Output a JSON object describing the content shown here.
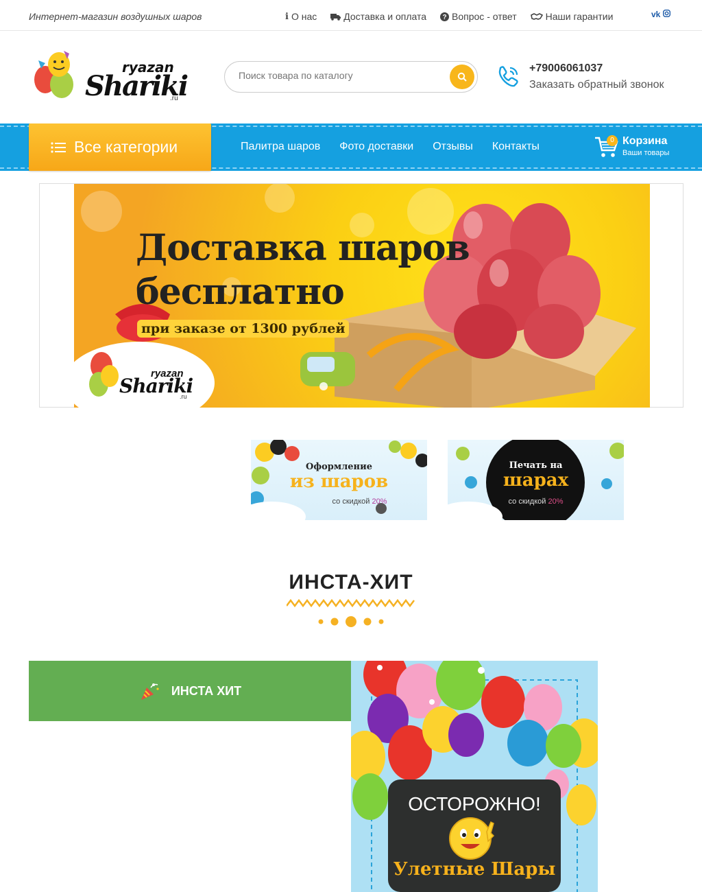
{
  "topbar": {
    "tagline": "Интернет-магазин воздушных шаров",
    "links": [
      "О нас",
      "Доставка и оплата",
      "Вопрос - ответ",
      "Наши гарантии"
    ],
    "social": [
      "vk-icon",
      "instagram-icon"
    ]
  },
  "header": {
    "logo_text": "Shariki",
    "logo_sub": "ryazan",
    "logo_domain": ".ru",
    "search_placeholder": "Поиск товара по каталогу",
    "phone": "+79006061037",
    "callback": "Заказать обратный звонок"
  },
  "nav": {
    "all_categories": "Все категории",
    "items": [
      "Палитра шаров",
      "Фото доставки",
      "Отзывы",
      "Контакты"
    ],
    "cart_title": "Корзина",
    "cart_sub": "Ваши товары",
    "cart_count": "0"
  },
  "slider": {
    "headline_1": "Доставка шаров",
    "headline_2": "бесплатно",
    "subline": "при заказе от 1300 рублей",
    "logo_sub": "ryazan",
    "logo_text": "Shariki",
    "logo_domain": ".ru"
  },
  "promos": [
    {
      "t1": "Оформление",
      "t2": "из шаров",
      "t3": "со скидкой",
      "pct": "20%"
    },
    {
      "t1": "Печать на",
      "t2": "шарах",
      "t3": "со скидкой",
      "pct": "20%"
    }
  ],
  "section": {
    "title": "ИНСТА-ХИТ",
    "tab_label": "ИНСТА ХИТ"
  },
  "insta": {
    "warn": "ОСТОРОЖНО!",
    "tagline": "Улетные Шары"
  },
  "colors": {
    "nav_blue": "#15a0e0",
    "accent_yellow": "#f8b61b",
    "tab_green": "#63ae52"
  }
}
